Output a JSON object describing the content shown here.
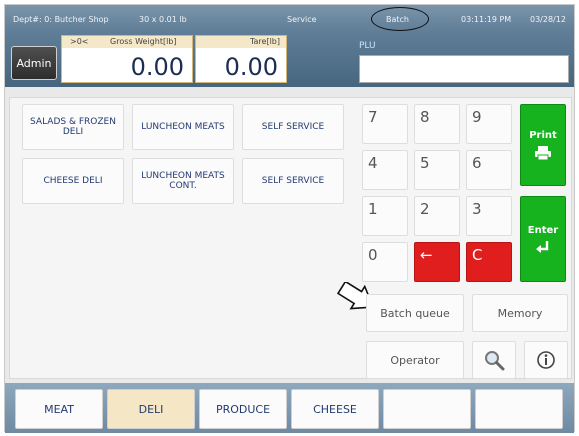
{
  "status": {
    "dept": "Dept#: 0: Butcher Shop",
    "scale": "30 x 0.01 lb",
    "mode": "Service",
    "batch": "Batch",
    "time": "03:11:19 PM",
    "date": "03/28/12"
  },
  "header": {
    "admin_label": "Admin",
    "gross": {
      "indicator": ">0<",
      "label": "Gross  Weight[lb]",
      "value": "0.00"
    },
    "tare": {
      "label": "Tare[lb]",
      "value": "0.00"
    },
    "plu_label": "PLU",
    "plu_value": ""
  },
  "departments": [
    "SALADS & FROZEN DELI",
    "LUNCHEON MEATS",
    "SELF SERVICE",
    "CHEESE DELI",
    "LUNCHEON MEATS CONT.",
    "SELF SERVICE"
  ],
  "keypad": {
    "keys": [
      "7",
      "8",
      "9",
      "4",
      "5",
      "6",
      "1",
      "2",
      "3",
      "0",
      "←",
      "C"
    ],
    "print_label": "Print",
    "enter_label": "Enter"
  },
  "actions": {
    "batch_queue": "Batch queue",
    "memory": "Memory",
    "operator": "Operator"
  },
  "tabs": [
    "MEAT",
    "DELI",
    "PRODUCE",
    "CHEESE",
    "",
    ""
  ],
  "active_tab": "DELI",
  "icons": {
    "search": "magnifier-icon",
    "info": "info-icon",
    "print": "printer-icon",
    "enter": "enter-arrow-icon",
    "pointer": "arrow-pointer-icon",
    "cursor": "mouse-cursor-icon"
  },
  "colors": {
    "green": "#17b31f",
    "red": "#e01e1e",
    "header": "#5f7d96",
    "tab_active": "#f5e7c6",
    "text_blue": "#233a72"
  }
}
